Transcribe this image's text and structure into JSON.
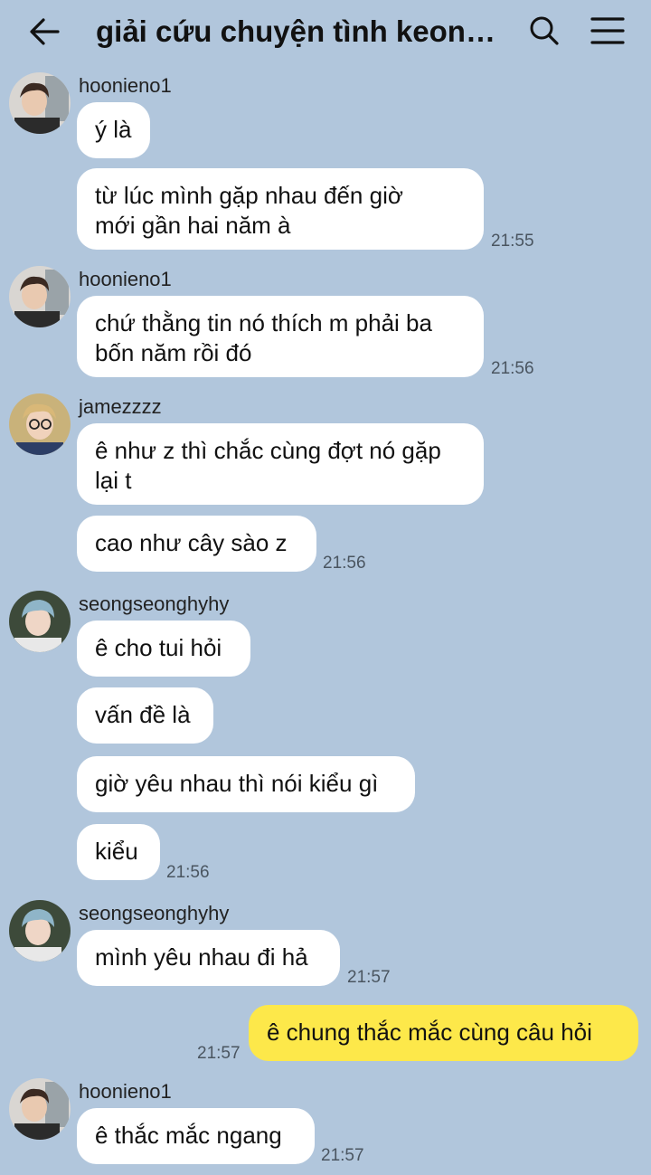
{
  "header": {
    "title": "giải cứu chuyện tình keonh…"
  },
  "messages": [
    {
      "sender": "hoonieno1",
      "bubbles": [
        "ý là",
        "từ lúc mình gặp nhau đến giờ",
        "mới gần hai năm à"
      ],
      "time": "21:55"
    },
    {
      "sender": "hoonieno1",
      "bubbles": [
        "chứ thằng tin nó thích m phải ba",
        "bốn năm rồi đó"
      ],
      "time": "21:56"
    },
    {
      "sender": "jamezzzz",
      "bubbles": [
        "ê như z thì chắc cùng đợt nó gặp",
        "lại t",
        "cao như cây sào z"
      ],
      "time": "21:56"
    },
    {
      "sender": "seongseonghyhy",
      "bubbles": [
        "ê cho tui hỏi",
        "vấn đề là",
        "giờ yêu nhau thì nói kiểu gì",
        "kiểu"
      ],
      "time": "21:56"
    },
    {
      "sender": "seongseonghyhy",
      "bubbles": [
        "mình yêu nhau đi hả"
      ],
      "time": "21:57"
    },
    {
      "sender": "me",
      "bubbles": [
        "ê chung thắc mắc cùng câu hỏi"
      ],
      "time": "21:57"
    },
    {
      "sender": "hoonieno1",
      "bubbles": [
        "ê thắc mắc ngang"
      ],
      "time": "21:57"
    }
  ],
  "colors": {
    "background": "#b1c6dc",
    "bubble_in": "#ffffff",
    "bubble_out": "#fde84a"
  },
  "icons": {
    "back": "arrow-left-icon",
    "search": "search-icon",
    "menu": "hamburger-menu-icon"
  }
}
